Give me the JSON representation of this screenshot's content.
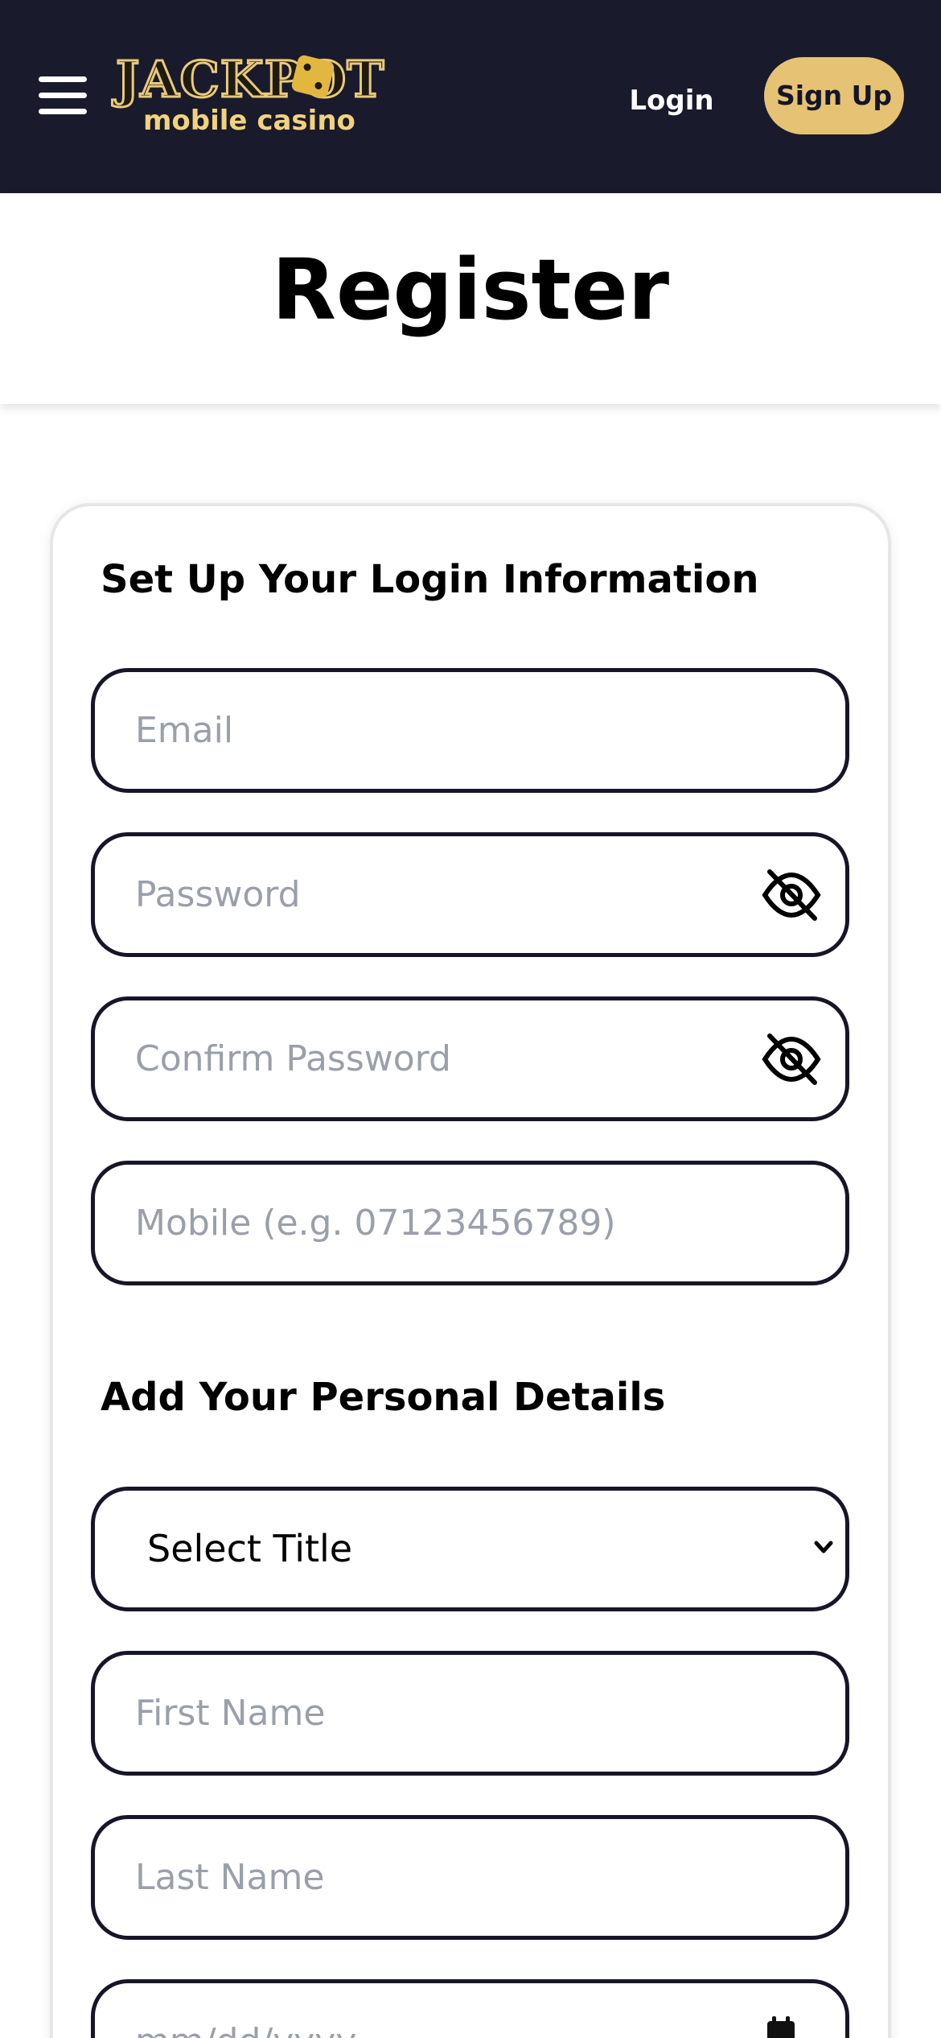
{
  "header": {
    "logo_top": "JACKPOT",
    "logo_bottom": "mobile casino",
    "login_label": "Login",
    "signup_label": "Sign Up",
    "menu_icon": "hamburger-menu-icon"
  },
  "page": {
    "title": "Register"
  },
  "login_section": {
    "heading": "Set Up Your Login Information",
    "email_placeholder": "Email",
    "password_placeholder": "Password",
    "confirm_password_placeholder": "Confirm Password",
    "mobile_placeholder": "Mobile (e.g. 07123456789)",
    "visibility_icon": "eye-slash-icon"
  },
  "personal_section": {
    "heading": "Add Your Personal Details",
    "title_select_value": "Select Title",
    "first_name_placeholder": "First Name",
    "last_name_placeholder": "Last Name",
    "dob_placeholder": "mm/dd/yyyy"
  },
  "colors": {
    "header_bg": "#191a2c",
    "accent_gold": "#e6c274",
    "field_border": "#161628",
    "placeholder": "#9aa0aa"
  }
}
